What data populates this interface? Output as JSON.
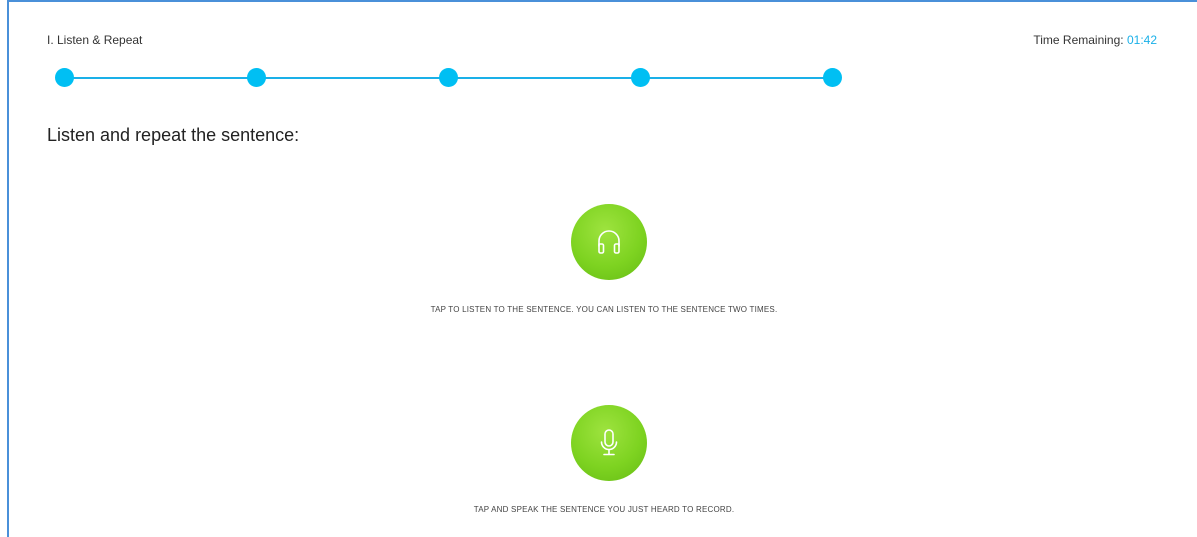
{
  "header": {
    "section_title": "I. Listen & Repeat",
    "timer_label": "Time Remaining:",
    "timer_value": "01:42"
  },
  "progress": {
    "steps_total": 5,
    "accent_color": "#00bff3"
  },
  "main": {
    "instruction": "Listen and repeat the sentence:",
    "listen": {
      "icon": "headphones-icon",
      "hint": "TAP TO LISTEN TO THE SENTENCE. YOU CAN LISTEN TO THE SENTENCE TWO TIMES."
    },
    "record": {
      "icon": "microphone-icon",
      "hint": "TAP AND SPEAK THE SENTENCE YOU JUST HEARD TO RECORD."
    },
    "button_color": "#7ed321"
  }
}
